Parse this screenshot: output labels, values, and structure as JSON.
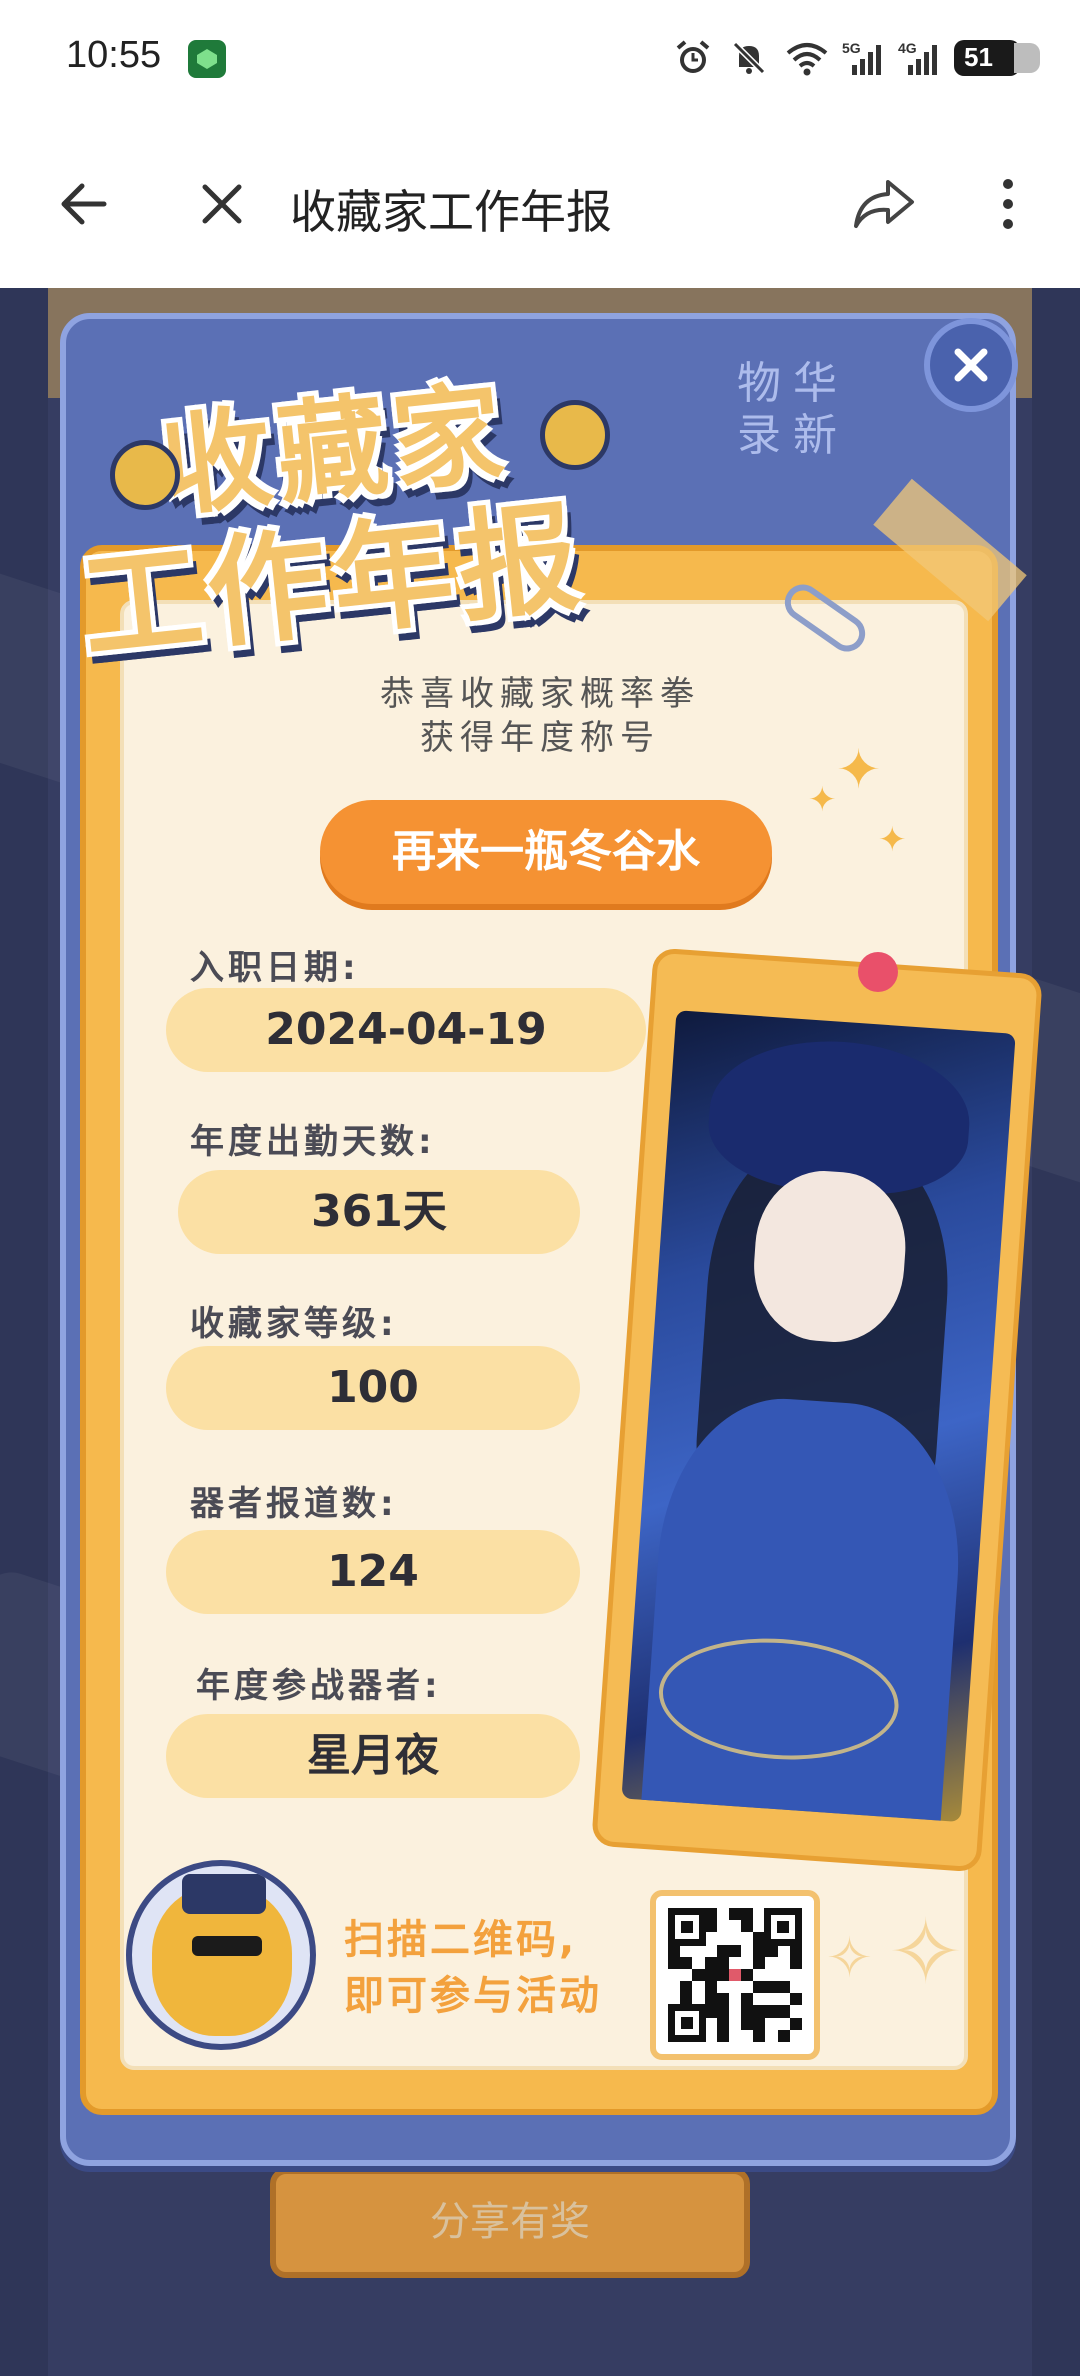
{
  "status_bar": {
    "time": "10:55",
    "battery": "51"
  },
  "header": {
    "title": "收藏家工作年报"
  },
  "background": {
    "share_button_label": "分享有奖"
  },
  "modal": {
    "seal_chars": [
      "华",
      "物",
      "新",
      "录"
    ],
    "logo": {
      "line1": "收藏家",
      "line2": "工作年报"
    },
    "congrats": {
      "line1": "恭喜收藏家概率拳",
      "line2": "获得年度称号"
    },
    "award_title": "再来一瓶冬谷水",
    "fields": [
      {
        "label": "入职日期:",
        "value": "2024-04-19"
      },
      {
        "label": "年度出勤天数:",
        "value": "361天"
      },
      {
        "label": "收藏家等级:",
        "value": "100"
      },
      {
        "label": "器者报道数:",
        "value": "124"
      },
      {
        "label": "年度参战器者:",
        "value": "星月夜"
      }
    ],
    "scan": {
      "line1": "扫描二维码,",
      "line2": "即可参与活动"
    }
  },
  "colors": {
    "modal_blue": "#5b70b5",
    "card_orange": "#f6b94d",
    "pill_orange": "#f59233",
    "pill_cream": "#fbe0a4"
  }
}
